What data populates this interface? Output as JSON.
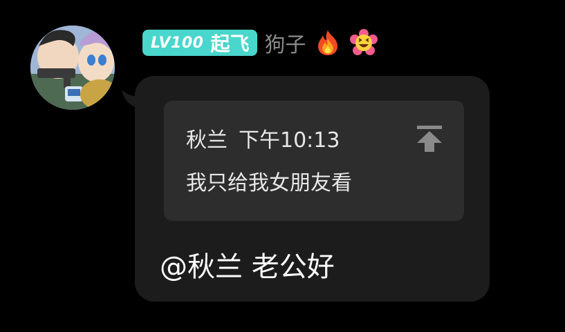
{
  "sender": {
    "level_label": "LV100",
    "level_title": "起飞",
    "name": "狗子",
    "emojis": [
      "fire-emoji",
      "grinning-flower-emoji"
    ],
    "badge_color": "#49d6cc"
  },
  "message": {
    "quote": {
      "author": "秋兰",
      "time": "下午10:13",
      "text": "我只给我女朋友看"
    },
    "text": "@秋兰 老公好"
  },
  "colors": {
    "background": "#000000",
    "bubble": "#1c1c1c",
    "quote_card": "#2d2d2d",
    "name": "#8a8a8a"
  }
}
